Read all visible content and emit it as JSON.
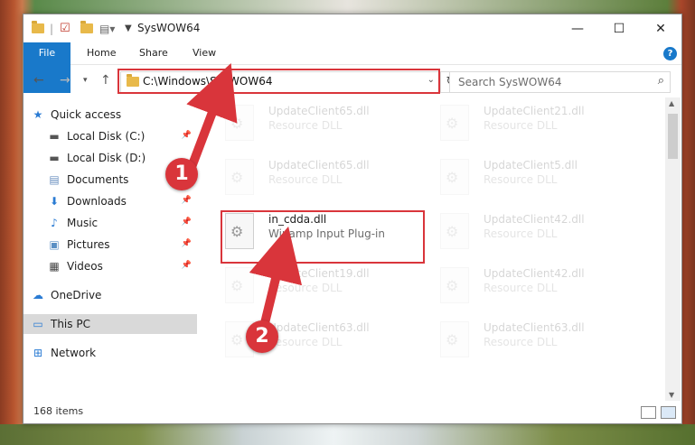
{
  "window": {
    "title": "SysWOW64",
    "minimize": "—",
    "maximize": "☐",
    "close": "✕"
  },
  "ribbon": {
    "tabs": [
      "File",
      "Home",
      "Share",
      "View"
    ],
    "help": "?"
  },
  "address": {
    "path": "C:\\Windows\\SysWOW64",
    "search_placeholder": "Search SysWOW64"
  },
  "nav": {
    "items": [
      {
        "label": "Quick access",
        "icon": "star-icon"
      },
      {
        "label": "Local Disk (C:)",
        "icon": "drive-icon"
      },
      {
        "label": "Local Disk (D:)",
        "icon": "drive-icon"
      },
      {
        "label": "Documents",
        "icon": "documents-icon"
      },
      {
        "label": "Downloads",
        "icon": "downloads-icon"
      },
      {
        "label": "Music",
        "icon": "music-icon"
      },
      {
        "label": "Pictures",
        "icon": "pictures-icon"
      },
      {
        "label": "Videos",
        "icon": "videos-icon"
      },
      {
        "label": "OneDrive",
        "icon": "cloud-icon"
      },
      {
        "label": "This PC",
        "icon": "computer-icon"
      },
      {
        "label": "Network",
        "icon": "network-icon"
      }
    ]
  },
  "files": [
    {
      "name": "UpdateClient65.dll",
      "type": "Resource DLL"
    },
    {
      "name": "UpdateClient21.dll",
      "type": "Resource DLL"
    },
    {
      "name": "UpdateClient65.dll",
      "type": "Resource DLL"
    },
    {
      "name": "UpdateClient5.dll",
      "type": "Resource DLL"
    },
    {
      "name": "in_cdda.dll",
      "type": "Winamp Input Plug-in"
    },
    {
      "name": "UpdateClient42.dll",
      "type": "Resource DLL"
    },
    {
      "name": "UpdateClient19.dll",
      "type": "Resource DLL"
    },
    {
      "name": "UpdateClient42.dll",
      "type": "Resource DLL"
    },
    {
      "name": "UpdateClient63.dll",
      "type": "Resource DLL"
    },
    {
      "name": "UpdateClient63.dll",
      "type": "Resource DLL"
    }
  ],
  "status": {
    "count": "168 items"
  },
  "annotations": {
    "step1": "1",
    "step2": "2",
    "color": "#d9353b"
  }
}
